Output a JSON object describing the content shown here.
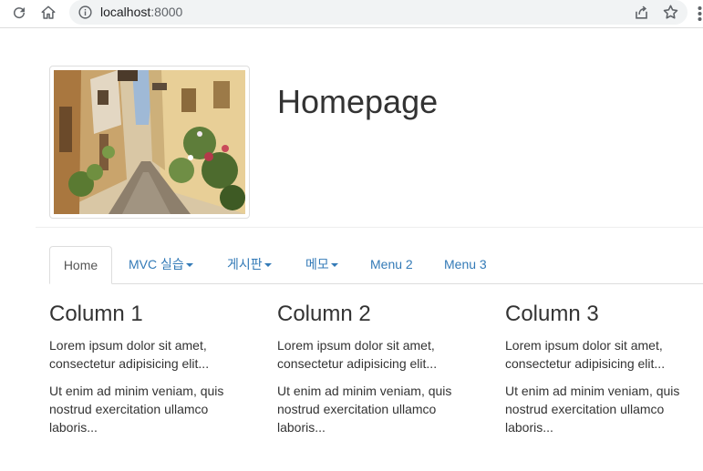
{
  "browser": {
    "url_host": "localhost",
    "url_port": ":8000"
  },
  "header": {
    "title": "Homepage"
  },
  "nav": {
    "tabs": [
      {
        "label": "Home",
        "active": true,
        "dropdown": false
      },
      {
        "label": "MVC 실습",
        "active": false,
        "dropdown": true
      },
      {
        "label": "게시판",
        "active": false,
        "dropdown": true
      },
      {
        "label": "메모",
        "active": false,
        "dropdown": true
      },
      {
        "label": "Menu 2",
        "active": false,
        "dropdown": false
      },
      {
        "label": "Menu 3",
        "active": false,
        "dropdown": false
      }
    ]
  },
  "columns": [
    {
      "title": "Column 1",
      "p1": "Lorem ipsum dolor sit amet, consectetur adipisicing elit...",
      "p2": "Ut enim ad minim veniam, quis nostrud exercitation ullamco laboris..."
    },
    {
      "title": "Column 2",
      "p1": "Lorem ipsum dolor sit amet, consectetur adipisicing elit...",
      "p2": "Ut enim ad minim veniam, quis nostrud exercitation ullamco laboris..."
    },
    {
      "title": "Column 3",
      "p1": "Lorem ipsum dolor sit amet, consectetur adipisicing elit...",
      "p2": "Ut enim ad minim veniam, quis nostrud exercitation ullamco laboris..."
    }
  ],
  "colors": {
    "link": "#337ab7",
    "text": "#333333",
    "border": "#dddddd"
  }
}
